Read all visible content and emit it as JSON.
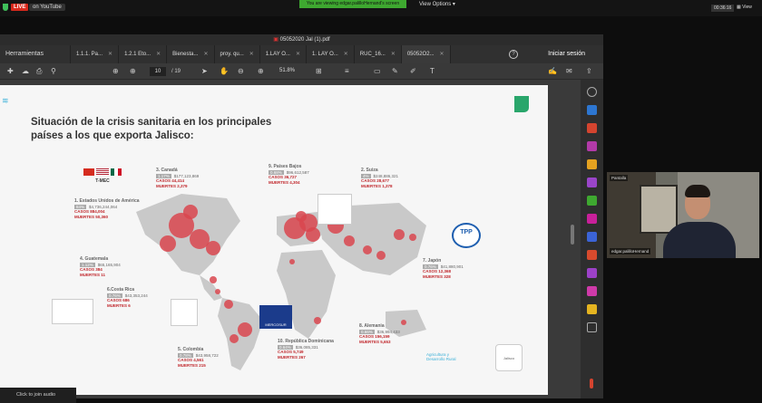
{
  "meet_bar": {
    "live_label": "LIVE",
    "live_on": "on YouTube",
    "viewing_banner": "You are viewing edgar.palilloHernand's screen",
    "view_options": "View Options",
    "clock": "00:36:16",
    "view_label": "View"
  },
  "acrobat": {
    "file_title": "05052020 Jal (1).pdf",
    "tools_tab": "Herramientas",
    "tabs": [
      "1.1.1. Pa...",
      "1.2.1 Eto...",
      "Bienesta...",
      "proy. qu...",
      "1.LAY O...",
      "1. LAY O...",
      "RUC_16...",
      "05052O2..."
    ],
    "sign_in": "Iniciar sesión",
    "page_current": "10",
    "page_total": "/ 19",
    "zoom": "51.8%"
  },
  "slide": {
    "title_line1": "Situación de la crisis sanitaria en los principales",
    "title_line2": "países a los que exporta Jalisco:",
    "tmec_label": "T-MEC",
    "mercosur_label": "MERCOSUR",
    "tpp_label": "TPP",
    "agri_label1": "Agricultura y",
    "agri_label2": "Desarrollo Rural",
    "jalisco_label": "Jalisco",
    "countries": [
      {
        "name": "1. Estados Unidos de América",
        "pct": "84%",
        "value": "$4,736,244,064",
        "cases": "CASOS 884,004",
        "deaths": "MUERTES 50,360"
      },
      {
        "name": "3. Canadá",
        "pct": "1.17%",
        "value": "$177,123,869",
        "cases": "CASOS 44,414",
        "deaths": "MUERTES 2,379"
      },
      {
        "name": "9. Países Bajos",
        "pct": "0.68%",
        "value": "$96,612,587",
        "cases": "CASOS 36,727",
        "deaths": "MUERTES 4,304"
      },
      {
        "name": "2. Suiza",
        "pct": "4%",
        "value": "$248,886,321",
        "cases": "CASOS 28,677",
        "deaths": "MUERTES 1,378"
      },
      {
        "name": "4. Guatemala",
        "pct": "1.12%",
        "value": "$65,165,904",
        "cases": "CASOS 384",
        "deaths": "MUERTES 11"
      },
      {
        "name": "6.Costa Rica",
        "pct": "0.76%",
        "value": "$43,353,244",
        "cases": "CASOS 686",
        "deaths": "MUERTES 6"
      },
      {
        "name": "7. Japón",
        "pct": "0.76%",
        "value": "$41,880,901",
        "cases": "CASOS 12,368",
        "deaths": "MUERTES 328"
      },
      {
        "name": "8. Alemania",
        "pct": "0.66%",
        "value": "$36,994,433",
        "cases": "CASOS 156,159",
        "deaths": "MUERTES 5,653"
      },
      {
        "name": "10. República Dominicana",
        "pct": "0.64%",
        "value": "$36,085,331",
        "cases": "CASOS 5,749",
        "deaths": "MUERTES 267"
      },
      {
        "name": "5. Colombia",
        "pct": "0.78%",
        "value": "$43,958,722",
        "cases": "CASOS 4,561",
        "deaths": "MUERTES 215"
      }
    ]
  },
  "participant": {
    "name": "edgar.palilloHernand",
    "top_label": "Pantalla"
  },
  "bottom": {
    "join_audio": "Click to join audio"
  },
  "colors": {
    "accent_green": "#29a66b",
    "bubble_red": "#d9474f",
    "live_red": "#d9291c"
  }
}
